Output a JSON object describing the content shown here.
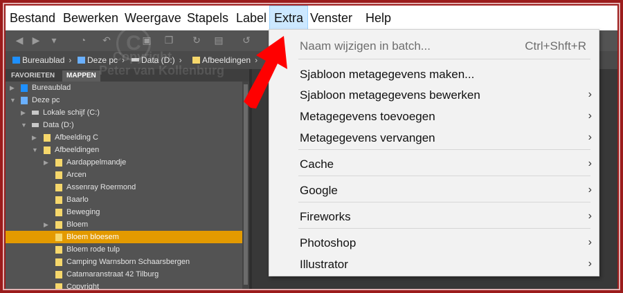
{
  "menubar": {
    "items": [
      "Bestand",
      "Bewerken",
      "Weergave",
      "Stapels",
      "Label",
      "Extra",
      "Venster",
      "Help"
    ],
    "active_index": 5
  },
  "pathbar": {
    "crumbs": [
      "Bureaublad",
      "Deze pc",
      "Data (D:)",
      "Afbeeldingen"
    ]
  },
  "panel": {
    "tabs": [
      "FAVORIETEN",
      "MAPPEN"
    ],
    "active_tab": "MAPPEN",
    "tree": [
      {
        "label": "Bureaublad",
        "icon": "desktop-icon"
      },
      {
        "label": "Deze pc",
        "icon": "computer-icon"
      },
      {
        "label": "Lokale schijf (C:)",
        "icon": "drive-icon"
      },
      {
        "label": "Data (D:)",
        "icon": "drive-icon"
      },
      {
        "label": "Afbeelding C",
        "icon": "folder-icon"
      },
      {
        "label": "Afbeeldingen",
        "icon": "folder-icon"
      },
      {
        "label": "Aardappelmandje",
        "icon": "folder-icon"
      },
      {
        "label": "Arcen",
        "icon": "folder-icon"
      },
      {
        "label": "Assenray Roermond",
        "icon": "folder-icon"
      },
      {
        "label": "Baarlo",
        "icon": "folder-icon"
      },
      {
        "label": "Beweging",
        "icon": "folder-icon"
      },
      {
        "label": "Bloem",
        "icon": "folder-icon"
      },
      {
        "label": "Bloem bloesem",
        "icon": "folder-icon",
        "selected": true
      },
      {
        "label": "Bloem rode tulp",
        "icon": "folder-icon"
      },
      {
        "label": "Camping Warnsborn Schaarsbergen",
        "icon": "folder-icon"
      },
      {
        "label": "Catamaranstraat 42 Tilburg",
        "icon": "folder-icon"
      },
      {
        "label": "Copyright",
        "icon": "folder-icon"
      }
    ]
  },
  "watermark": {
    "symbol": "C",
    "line1": "Copyright",
    "line2": "Peter van Kollenburg"
  },
  "extra_menu": {
    "items": [
      {
        "label": "Naam wijzigen in batch...",
        "shortcut": "Ctrl+Shft+R",
        "disabled": true
      },
      {
        "label": "Sjabloon metagegevens maken..."
      },
      {
        "label": "Sjabloon metagegevens bewerken",
        "submenu": true
      },
      {
        "label": "Metagegevens toevoegen",
        "submenu": true
      },
      {
        "label": "Metagegevens vervangen",
        "submenu": true
      },
      {
        "label": "Cache",
        "submenu": true
      },
      {
        "label": "Google",
        "submenu": true
      },
      {
        "label": "Fireworks",
        "submenu": true
      },
      {
        "label": "Photoshop",
        "submenu": true
      },
      {
        "label": "Illustrator",
        "submenu": true
      }
    ],
    "submenu_glyph": "›"
  },
  "colors": {
    "frame": "#9b1c1c",
    "selection": "#e39a00",
    "annotation_arrow": "#ff0000",
    "active_menu": "#cce8ff"
  }
}
